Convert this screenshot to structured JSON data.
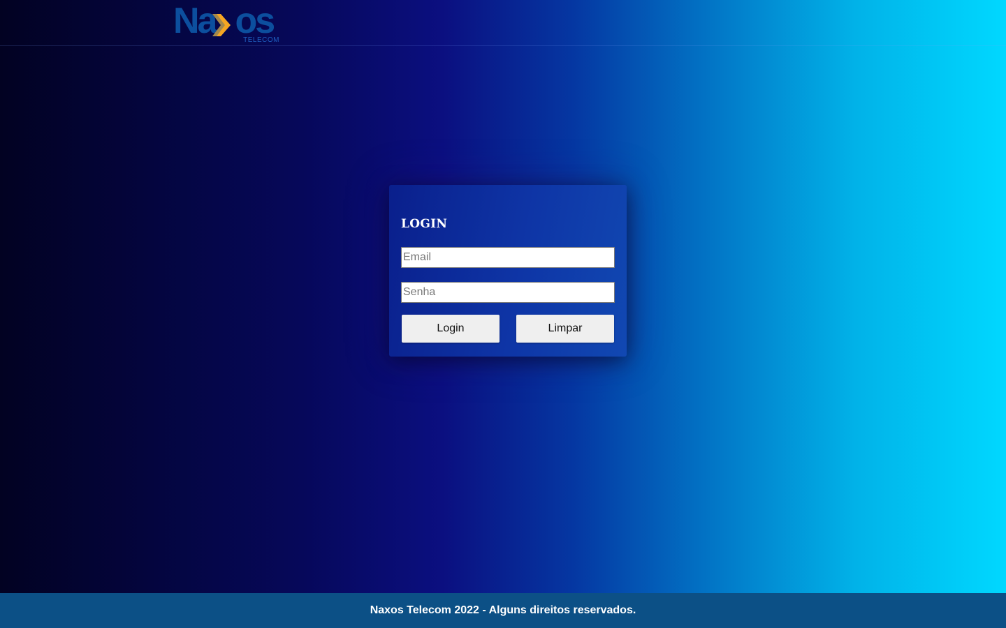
{
  "header": {
    "logo": {
      "word_left": "Na",
      "word_right": "os",
      "subtitle": "TELECOM",
      "brand_color": "#0c4f9e",
      "accent_color": "#f5a623",
      "icon": "chevron-right-icon"
    }
  },
  "login": {
    "title": "LOGIN",
    "email": {
      "placeholder": "Email",
      "value": ""
    },
    "senha": {
      "placeholder": "Senha",
      "value": ""
    },
    "login_button": "Login",
    "clear_button": "Limpar"
  },
  "footer": {
    "text": "Naxos Telecom 2022 - Alguns direitos reservados."
  },
  "colors": {
    "background_left": "#020222",
    "background_mid": "#0b0f80",
    "background_right": "#00d8ff",
    "card": "#0e35a6",
    "footer": "#0c5086",
    "button": "#efefef"
  }
}
